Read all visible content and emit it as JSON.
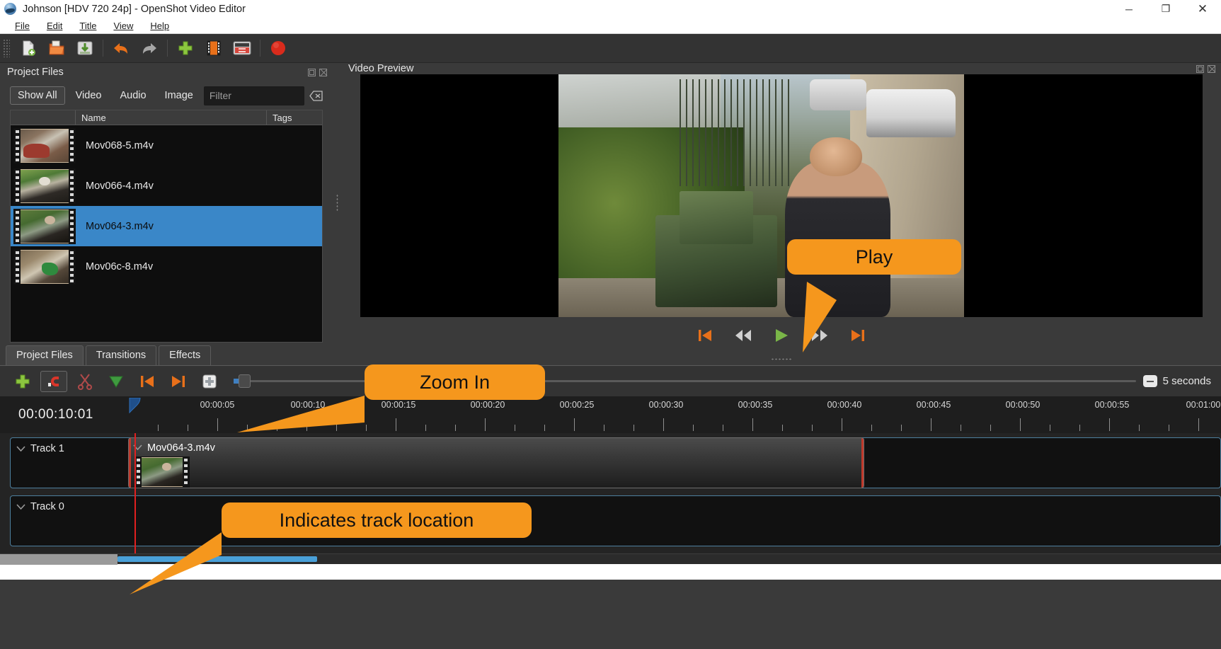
{
  "window": {
    "title": "Johnson [HDV 720 24p] - OpenShot Video Editor",
    "logo_icon": "openshot-logo-icon",
    "controls": {
      "minimize": "─",
      "maximize": "❐",
      "close": "✕"
    }
  },
  "menubar": {
    "items": [
      {
        "label": "File",
        "mnemonic": "F"
      },
      {
        "label": "Edit",
        "mnemonic": "E"
      },
      {
        "label": "Title",
        "mnemonic": "T"
      },
      {
        "label": "View",
        "mnemonic": "V"
      },
      {
        "label": "Help",
        "mnemonic": "H"
      }
    ]
  },
  "toolbar": {
    "buttons": [
      {
        "name": "new-project-icon",
        "title": "New Project"
      },
      {
        "name": "open-project-icon",
        "title": "Open Project"
      },
      {
        "name": "save-project-icon",
        "title": "Save Project"
      },
      {
        "name": "undo-icon",
        "title": "Undo"
      },
      {
        "name": "redo-icon",
        "title": "Redo"
      },
      {
        "name": "import-files-icon",
        "title": "Import Files"
      },
      {
        "name": "profile-film-icon",
        "title": "Choose Profile"
      },
      {
        "name": "export-video-icon",
        "title": "Export Video"
      },
      {
        "name": "record-icon",
        "title": "Record"
      }
    ]
  },
  "project_files_panel": {
    "title": "Project Files",
    "header_icons": [
      "float-panel-icon",
      "close-panel-icon"
    ],
    "filters": [
      {
        "label": "Show All",
        "active": true
      },
      {
        "label": "Video",
        "active": false
      },
      {
        "label": "Audio",
        "active": false
      },
      {
        "label": "Image",
        "active": false
      }
    ],
    "filter_input": {
      "value": "",
      "placeholder": "Filter"
    },
    "clear_icon": "clear-filter-icon",
    "columns": [
      "",
      "Name",
      "Tags"
    ],
    "files": [
      {
        "name": "Mov068-5.m4v",
        "tags": "",
        "selected": false
      },
      {
        "name": "Mov066-4.m4v",
        "tags": "",
        "selected": false
      },
      {
        "name": "Mov064-3.m4v",
        "tags": "",
        "selected": true
      },
      {
        "name": "Mov06c-8.m4v",
        "tags": "",
        "selected": false
      }
    ]
  },
  "video_preview_panel": {
    "title": "Video Preview",
    "header_icons": [
      "float-panel-icon",
      "close-panel-icon"
    ],
    "controls": [
      {
        "name": "jump-to-start-button",
        "glyph": "skip-start-icon"
      },
      {
        "name": "rewind-button",
        "glyph": "rewind-icon"
      },
      {
        "name": "play-button",
        "glyph": "play-icon"
      },
      {
        "name": "fast-forward-button",
        "glyph": "fast-forward-icon"
      },
      {
        "name": "jump-to-end-button",
        "glyph": "skip-end-icon"
      }
    ]
  },
  "bottom_tabs": [
    {
      "label": "Project Files",
      "active": true
    },
    {
      "label": "Transitions",
      "active": false
    },
    {
      "label": "Effects",
      "active": false
    }
  ],
  "timeline_toolbar": {
    "buttons": [
      {
        "name": "add-track-button",
        "glyph": "plus-icon"
      },
      {
        "name": "snapping-toggle-button",
        "glyph": "magnet-icon",
        "pressed": true
      },
      {
        "name": "razor-tool-button",
        "glyph": "scissors-icon"
      },
      {
        "name": "add-marker-button",
        "glyph": "marker-triangle-icon"
      },
      {
        "name": "previous-marker-button",
        "glyph": "skip-start-icon"
      },
      {
        "name": "next-marker-button",
        "glyph": "skip-end-icon"
      },
      {
        "name": "center-playhead-button",
        "glyph": "center-playhead-icon"
      }
    ],
    "zoom_level_label": "5 seconds",
    "zoom_out_icon": "zoom-out-icon"
  },
  "timeline": {
    "playhead_timecode": "00:00:10:01",
    "ruler_labels": [
      "00:00:05",
      "00:00:10",
      "00:00:15",
      "00:00:20",
      "00:00:25",
      "00:00:30",
      "00:00:35",
      "00:00:40",
      "00:00:45",
      "00:00:50",
      "00:00:55",
      "00:01:00"
    ],
    "tracks": [
      {
        "name": "Track 1",
        "collapse_icon": "chevron-down-icon",
        "clips": [
          {
            "name": "Mov064-3.m4v",
            "collapse_icon": "chevron-down-icon"
          }
        ]
      },
      {
        "name": "Track 0",
        "collapse_icon": "chevron-down-icon",
        "clips": []
      }
    ]
  },
  "callouts": [
    {
      "text": "Play",
      "name": "callout-play"
    },
    {
      "text": "Zoom In",
      "name": "callout-zoom-in"
    },
    {
      "text": "Indicates track location",
      "name": "callout-track-location"
    }
  ],
  "colors": {
    "accent_orange": "#f5971d",
    "selection_blue": "#3a87c8",
    "playhead_red": "#e02020",
    "track_border": "#4d7f9e"
  }
}
